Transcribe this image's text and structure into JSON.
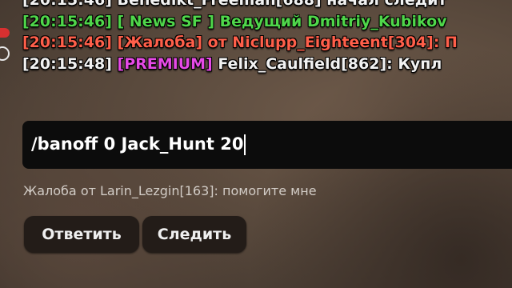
{
  "chat": {
    "lines": [
      {
        "time": "[20:15:46]",
        "rest": " Benedikt_Freeman[688] начал следит"
      },
      {
        "time": "[20:15:46]",
        "tag": " [ News SF ]",
        "rest": " Ведущий Dmitriy_Kubikov"
      },
      {
        "time": "[20:15:46]",
        "tag": " [Жалоба]",
        "rest": " от Niclupp_Eighteent[304]: П"
      },
      {
        "time": "[20:15:48]",
        "tag": " [PREMIUM]",
        "rest": " Felix_Caulfield[862]: Купл"
      }
    ]
  },
  "input": {
    "value": "/banoff 0 Jack_Hunt 20"
  },
  "notice": {
    "text": "Жалоба от Larin_Lezgin[163]: помогите мне"
  },
  "buttons": {
    "reply": "Ответить",
    "follow": "Следить"
  },
  "colors": {
    "chat_text": "#f2f2f2",
    "news": "#4fd64a",
    "report": "#ff5f4a",
    "premium": "#e64ae6",
    "input_bg": "#0c0c0c",
    "button_bg": "#231c18"
  },
  "icons": {
    "side_top": "red-indicator-icon",
    "side_bottom": "ring-indicator-icon"
  }
}
